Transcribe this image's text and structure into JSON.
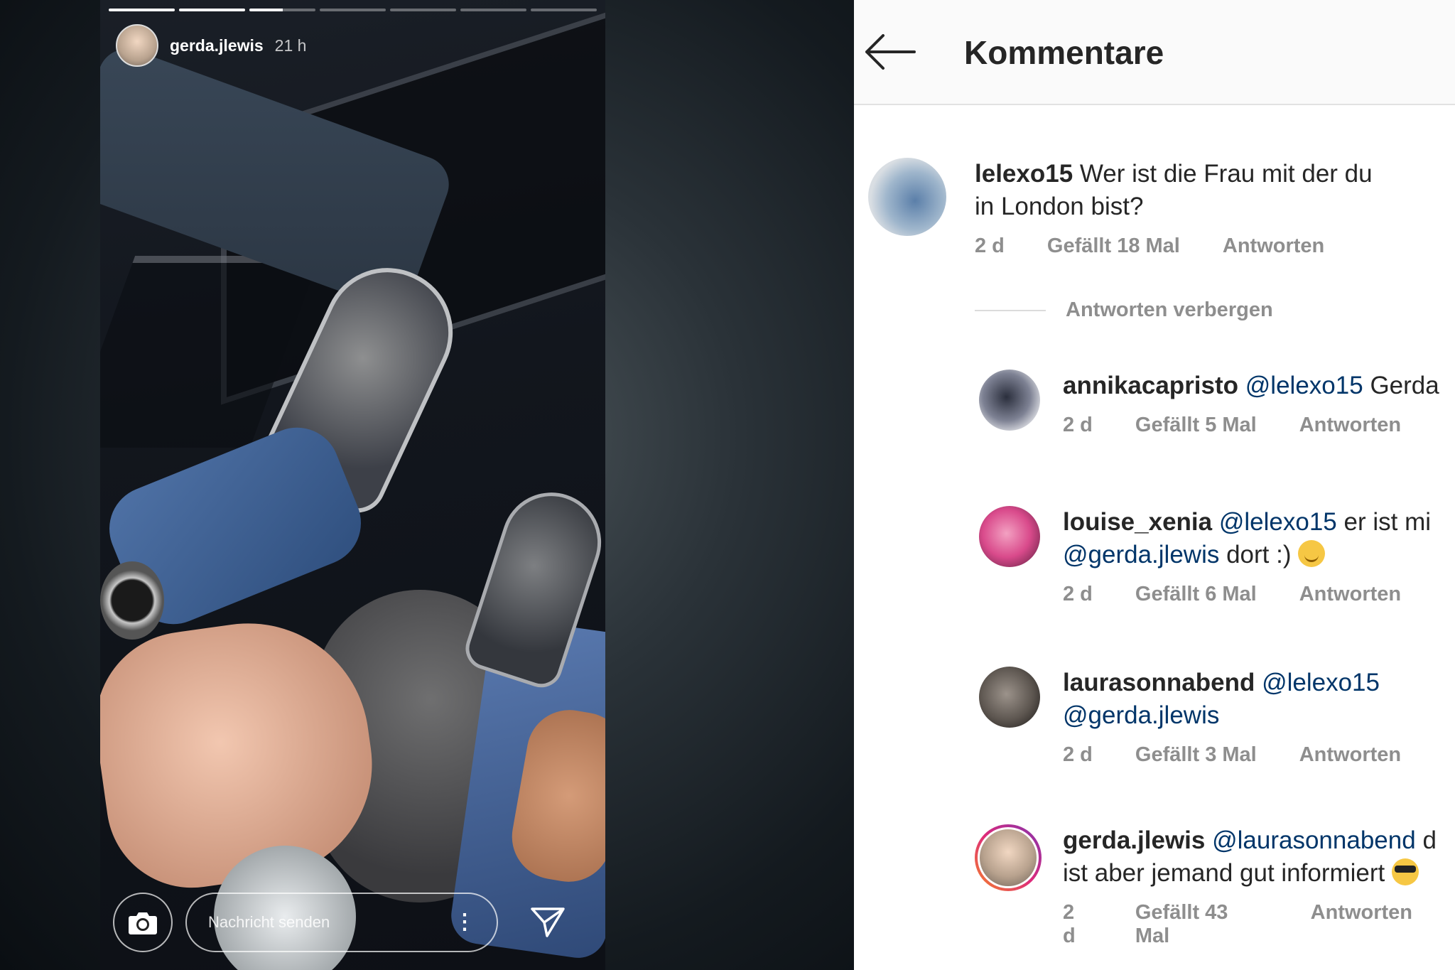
{
  "story": {
    "progress_fill": [
      1,
      1,
      0.5,
      0,
      0,
      0,
      0
    ],
    "username": "gerda.jlewis",
    "time": "21 h",
    "message_placeholder": "Nachricht senden",
    "more_label": "⋮"
  },
  "comments_view": {
    "title": "Kommentare",
    "main_comment": {
      "user": "lelexo15",
      "text_line1": "Wer ist die Frau mit der du",
      "text_line2": "in London bist?",
      "age": "2 d",
      "likes": "Gefällt 18 Mal",
      "reply": "Antworten"
    },
    "hide_replies": "Antworten verbergen",
    "replies": [
      {
        "user": "annikacapristo",
        "mention": "@lelexo15",
        "text": "Gerda",
        "age": "2 d",
        "likes": "Gefällt 5 Mal",
        "reply": "Antworten"
      },
      {
        "user": "louise_xenia",
        "mention": "@lelexo15",
        "text": "er ist mi",
        "mention2": "@gerda.jlewis",
        "text2": " dort :)",
        "emoji": "smile",
        "age": "2 d",
        "likes": "Gefällt 6 Mal",
        "reply": "Antworten"
      },
      {
        "user": "laurasonnabend",
        "mention": "@lelexo15",
        "mention2": "@gerda.jlewis",
        "age": "2 d",
        "likes": "Gefällt 3 Mal",
        "reply": "Antworten"
      },
      {
        "user": "gerda.jlewis",
        "mention": "@laurasonnabend",
        "text": "d",
        "text2": "ist aber jemand gut informiert",
        "emoji": "cool",
        "age": "2 d",
        "likes": "Gefällt 43 Mal",
        "reply": "Antworten"
      }
    ]
  },
  "colors": {
    "mention": "#003569",
    "meta_gray": "#8e8e8e",
    "text": "#262626",
    "story_ring": "#e1306c"
  }
}
